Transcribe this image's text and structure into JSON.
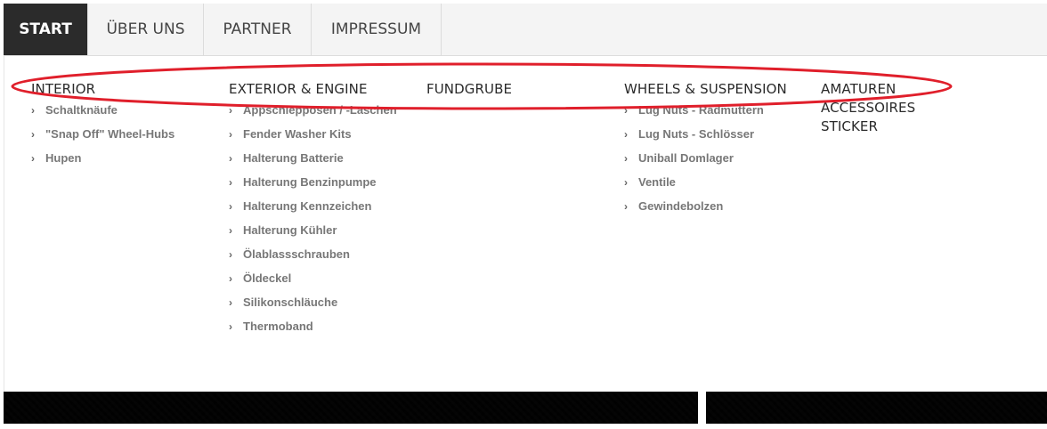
{
  "nav": {
    "tabs": [
      {
        "label": "START",
        "active": true
      },
      {
        "label": "ÜBER UNS",
        "active": false
      },
      {
        "label": "PARTNER",
        "active": false
      },
      {
        "label": "IMPRESSUM",
        "active": false
      }
    ]
  },
  "menu": {
    "interior": {
      "title": "INTERIOR",
      "items": [
        "Schaltknäufe",
        "\"Snap Off\" Wheel-Hubs",
        "Hupen"
      ]
    },
    "exterior": {
      "title": "EXTERIOR & ENGINE",
      "items": [
        "Appschleppösen / -Laschen",
        "Fender Washer Kits",
        "Halterung Batterie",
        "Halterung Benzinpumpe",
        "Halterung Kennzeichen",
        "Halterung Kühler",
        "Ölablassschrauben",
        "Öldeckel",
        "Silikonschläuche",
        "Thermoband"
      ]
    },
    "fundgrube": {
      "title": "FUNDGRUBE"
    },
    "wheels": {
      "title": "WHEELS & SUSPENSION",
      "items": [
        "Lug Nuts - Radmuttern",
        "Lug Nuts - Schlösser",
        "Uniball Domlager",
        "Ventile",
        "Gewindebolzen"
      ]
    },
    "extra": {
      "amaturen": "AMATUREN",
      "accessoires": "ACCESSOIRES",
      "sticker": "STICKER"
    },
    "chevron": "›"
  },
  "colors": {
    "active_tab_bg": "#2b2b2b",
    "annotation": "#e01f2b"
  }
}
